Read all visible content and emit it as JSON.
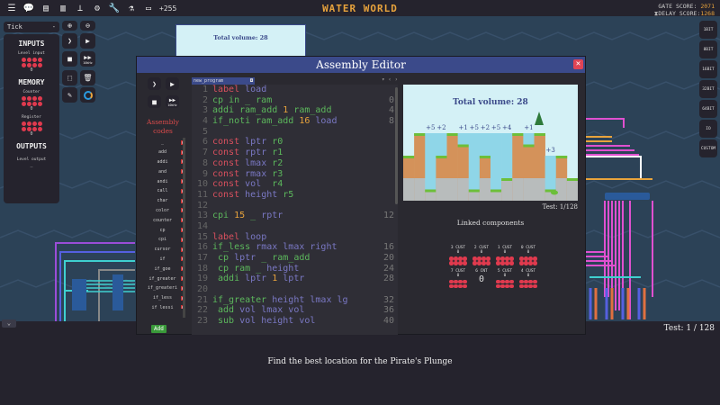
{
  "topbar": {
    "icons": [
      "menu-icon",
      "chat-icon",
      "file-icon",
      "book-icon",
      "hierarchy-icon",
      "gear-icon",
      "wrench-icon",
      "flask-icon",
      "chip-icon"
    ],
    "counter": "+255",
    "title": "WATER WORLD",
    "gate_score_label": "GATE SCORE:",
    "gate_score": "2071",
    "delay_score_label": "DELAY SCORE:",
    "delay_score": "1268"
  },
  "tick_select": {
    "value": "Tick",
    "arrow": "-"
  },
  "left_panel": {
    "inputs_title": "INPUTS",
    "level_input_label": "Level input",
    "level_input_value": "0",
    "memory_title": "MEMORY",
    "counter_label": "Counter",
    "counter_value": "0",
    "register_label": "Register",
    "register_value": "0",
    "outputs_title": "OUTPUTS",
    "level_output_label": "Level output",
    "level_output_value": "_"
  },
  "sim_controls": {
    "speed_label": "10kHz"
  },
  "right_buttons": [
    "1BIT",
    "8BIT",
    "16BIT",
    "32BIT",
    "64BIT",
    "IO",
    "CUSTOM"
  ],
  "preview": {
    "title": "Total volume: 28"
  },
  "editor": {
    "title": "Assembly Editor",
    "close": "✕",
    "assembly_title": "Assembly codes",
    "add_label": "Add",
    "tab_name": "new_program",
    "speed_label": "10kHz",
    "codes": [
      "_",
      "add",
      "addi",
      "and",
      "andi",
      "call",
      "char",
      "color",
      "counter",
      "cp",
      "cpi",
      "cursor",
      "if",
      "if_goe",
      "if_greater",
      "if_greateri",
      "if_less",
      "if_lessi"
    ],
    "lines": [
      {
        "n": "1",
        "a": "",
        "t": [
          [
            "label",
            "kw"
          ],
          [
            " load",
            "id"
          ]
        ]
      },
      {
        "n": "2",
        "a": "0",
        "t": [
          [
            "cp in _ ram",
            "op"
          ]
        ]
      },
      {
        "n": "3",
        "a": "4",
        "t": [
          [
            "addi ram_add ",
            "op"
          ],
          [
            "1",
            "num"
          ],
          [
            " ram_add",
            "op"
          ]
        ]
      },
      {
        "n": "4",
        "a": "8",
        "t": [
          [
            "if_noti ram_add ",
            "op"
          ],
          [
            "16",
            "num"
          ],
          [
            " load",
            "id"
          ]
        ]
      },
      {
        "n": "5",
        "a": "",
        "t": []
      },
      {
        "n": "6",
        "a": "",
        "t": [
          [
            "const",
            "kw"
          ],
          [
            " lptr",
            "id"
          ],
          [
            " r0",
            "reg"
          ]
        ]
      },
      {
        "n": "7",
        "a": "",
        "t": [
          [
            "const",
            "kw"
          ],
          [
            " rptr",
            "id"
          ],
          [
            " r1",
            "reg"
          ]
        ]
      },
      {
        "n": "8",
        "a": "",
        "t": [
          [
            "const",
            "kw"
          ],
          [
            " lmax",
            "id"
          ],
          [
            " r2",
            "reg"
          ]
        ]
      },
      {
        "n": "9",
        "a": "",
        "t": [
          [
            "const",
            "kw"
          ],
          [
            " rmax",
            "id"
          ],
          [
            " r3",
            "reg"
          ]
        ]
      },
      {
        "n": "10",
        "a": "",
        "t": [
          [
            "const",
            "kw"
          ],
          [
            " vol ",
            "id"
          ],
          [
            " r4",
            "reg"
          ]
        ]
      },
      {
        "n": "11",
        "a": "",
        "t": [
          [
            "const",
            "kw"
          ],
          [
            " height",
            "id"
          ],
          [
            " r5",
            "reg"
          ]
        ]
      },
      {
        "n": "12",
        "a": "",
        "t": []
      },
      {
        "n": "13",
        "a": "12",
        "t": [
          [
            "cpi ",
            "op"
          ],
          [
            "15",
            "num"
          ],
          [
            " _ ",
            "op"
          ],
          [
            "rptr",
            "id"
          ]
        ]
      },
      {
        "n": "14",
        "a": "",
        "t": []
      },
      {
        "n": "15",
        "a": "",
        "t": [
          [
            "label",
            "kw"
          ],
          [
            " loop",
            "id"
          ]
        ]
      },
      {
        "n": "16",
        "a": "16",
        "t": [
          [
            "if_less ",
            "op"
          ],
          [
            "rmax lmax",
            "id"
          ],
          [
            " right",
            "id"
          ]
        ]
      },
      {
        "n": "17",
        "a": "20",
        "t": [
          [
            " cp ",
            "op"
          ],
          [
            "lptr",
            "id"
          ],
          [
            " _ ram_add",
            "op"
          ]
        ]
      },
      {
        "n": "18",
        "a": "24",
        "t": [
          [
            " cp ram _ ",
            "op"
          ],
          [
            "height",
            "id"
          ]
        ]
      },
      {
        "n": "19",
        "a": "28",
        "t": [
          [
            " addi ",
            "op"
          ],
          [
            "lptr",
            "id"
          ],
          [
            " 1",
            "num"
          ],
          [
            " lptr",
            "id"
          ]
        ]
      },
      {
        "n": "20",
        "a": "",
        "t": []
      },
      {
        "n": "21",
        "a": "32",
        "t": [
          [
            "if_greater ",
            "op"
          ],
          [
            "height lmax",
            "id"
          ],
          [
            " lg",
            "id"
          ]
        ]
      },
      {
        "n": "22",
        "a": "36",
        "t": [
          [
            " add ",
            "op"
          ],
          [
            "vol lmax vol",
            "id"
          ]
        ]
      },
      {
        "n": "23",
        "a": "40",
        "t": [
          [
            " sub ",
            "op"
          ],
          [
            "vol height vol",
            "id"
          ]
        ]
      }
    ],
    "game": {
      "title": "Total volume: 28",
      "columns": [
        4,
        6,
        1,
        4,
        6,
        5,
        1,
        4,
        1,
        2,
        6,
        5,
        6,
        1,
        4,
        2
      ],
      "water": [
        0,
        0,
        5,
        2,
        0,
        1,
        5,
        2,
        5,
        4,
        0,
        1,
        0,
        3,
        0,
        0
      ],
      "water_labels": [
        "+5",
        "+2",
        "+1",
        "+5",
        "+2",
        "+5",
        "+4",
        "+1",
        "+3"
      ]
    },
    "test_label": "Test: 1/128",
    "linked_title": "Linked components",
    "components": [
      {
        "label": "3 CUST",
        "value": "0"
      },
      {
        "label": "2 CUST",
        "value": "0"
      },
      {
        "label": "1 CUST",
        "value": "0"
      },
      {
        "label": "0 CUST",
        "value": "0"
      },
      {
        "label": "7 CUST",
        "value": "0"
      },
      {
        "label": "6 CNT",
        "value": "0",
        "big": true
      },
      {
        "label": "5 CUST",
        "value": "0"
      },
      {
        "label": "4 CUST",
        "value": "0"
      }
    ]
  },
  "bottom": {
    "test": "Test: 1 / 128",
    "message": "Find the best location for the Pirate's Plunge",
    "collapse": "⌄"
  },
  "colors": {
    "accent": "#e8a33c",
    "window_title": "#3b4a8a",
    "keyword": "#d8505e",
    "op": "#5cb85c",
    "ident": "#7a78c4",
    "led": "#e03a4e"
  }
}
